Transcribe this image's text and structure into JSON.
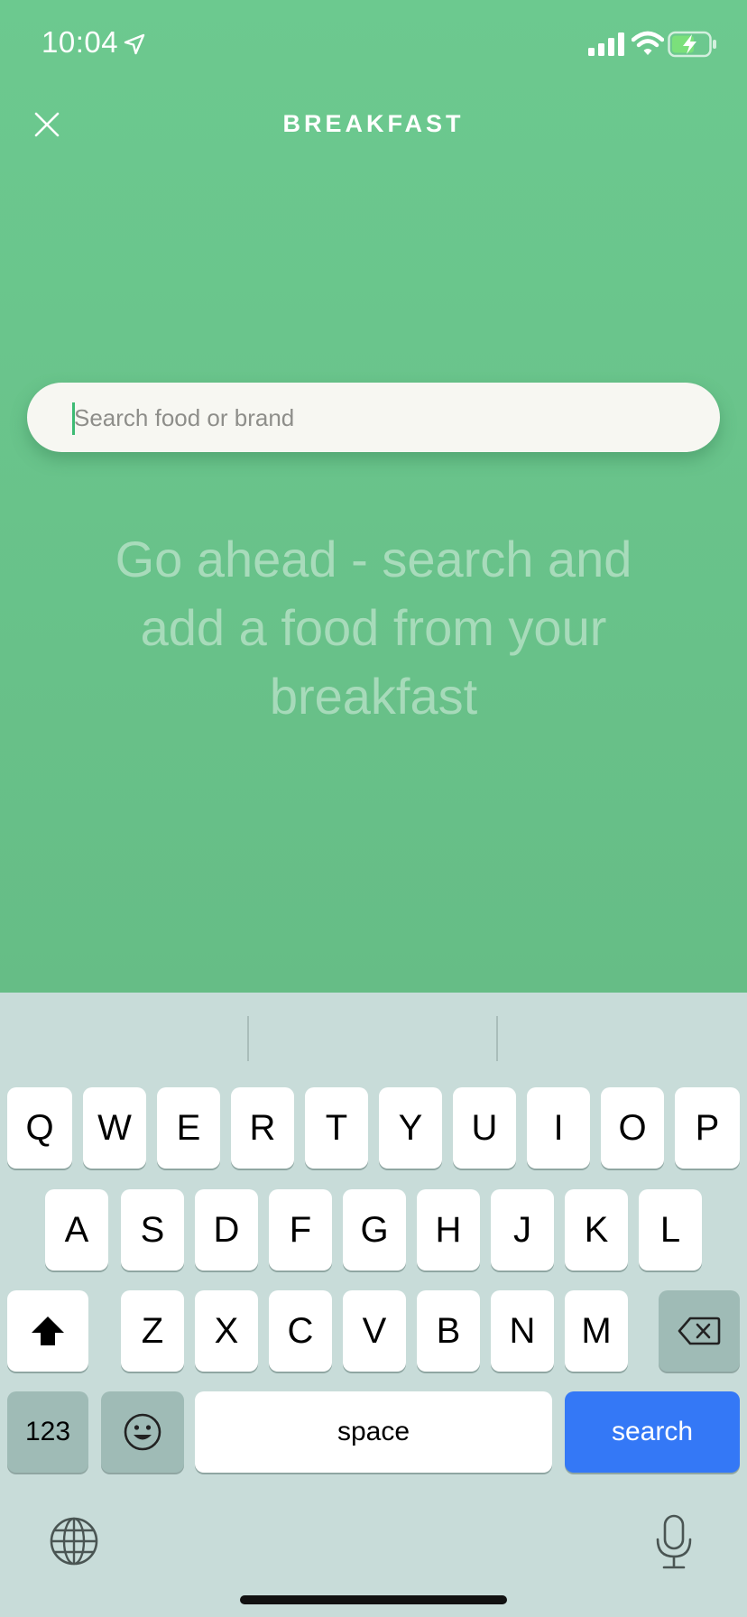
{
  "status_bar": {
    "time": "10:04"
  },
  "header": {
    "title": "BREAKFAST"
  },
  "search": {
    "placeholder": "Search food or brand",
    "value": ""
  },
  "empty_state": {
    "message": "Go ahead - search and add a food from your breakfast"
  },
  "colors": {
    "background": "#6cc98e",
    "accent": "#3dbb74",
    "search_key": "#3478f6"
  },
  "keyboard": {
    "row1": [
      "Q",
      "W",
      "E",
      "R",
      "T",
      "Y",
      "U",
      "I",
      "O",
      "P"
    ],
    "row2": [
      "A",
      "S",
      "D",
      "F",
      "G",
      "H",
      "J",
      "K",
      "L"
    ],
    "row3": [
      "Z",
      "X",
      "C",
      "V",
      "B",
      "N",
      "M"
    ],
    "numbers_label": "123",
    "space_label": "space",
    "search_label": "search",
    "icons": [
      "shift-icon",
      "delete-icon",
      "emoji-icon",
      "globe-icon",
      "mic-icon"
    ]
  }
}
